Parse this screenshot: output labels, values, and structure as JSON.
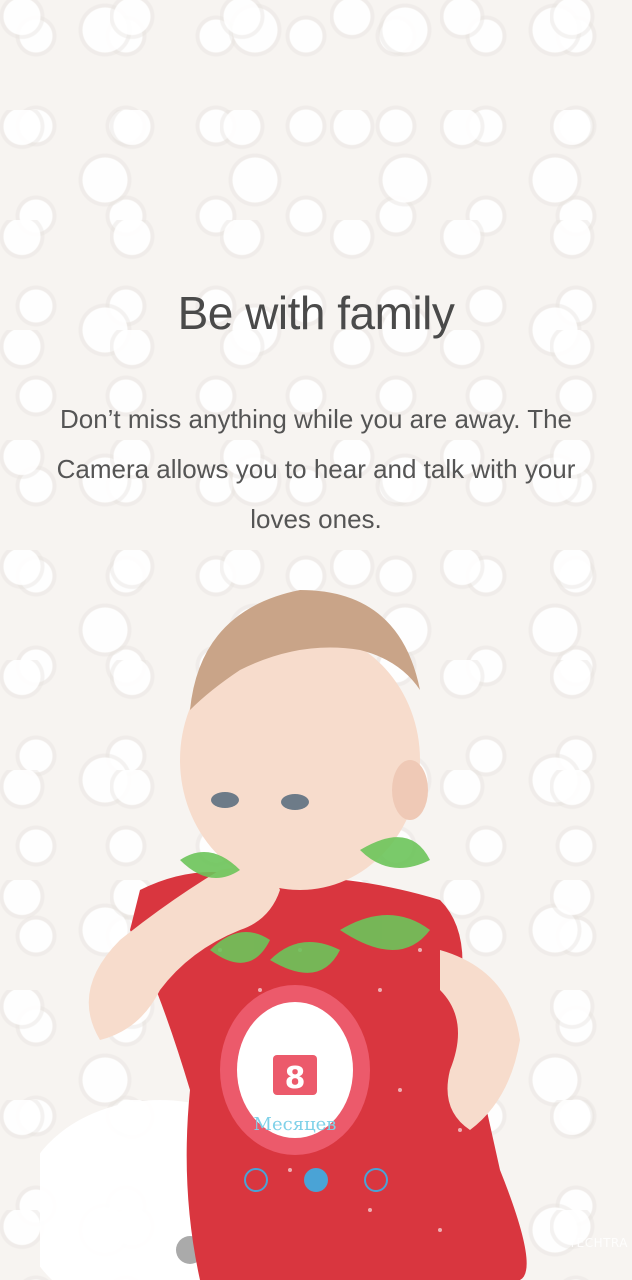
{
  "slide": {
    "title": "Be with family",
    "description": "Don’t miss anything while you are away. The Camera allows you to hear and talk with your loves ones."
  },
  "illustration": {
    "badge_number": "8",
    "badge_text": "Месяцев"
  },
  "pagination": {
    "count": 3,
    "active_index": 1
  },
  "watermark": {
    "text": "TECHTRA"
  },
  "colors": {
    "accent": "#4aa3d6",
    "dress": "#d9363f",
    "leaf": "#6cc45a"
  }
}
